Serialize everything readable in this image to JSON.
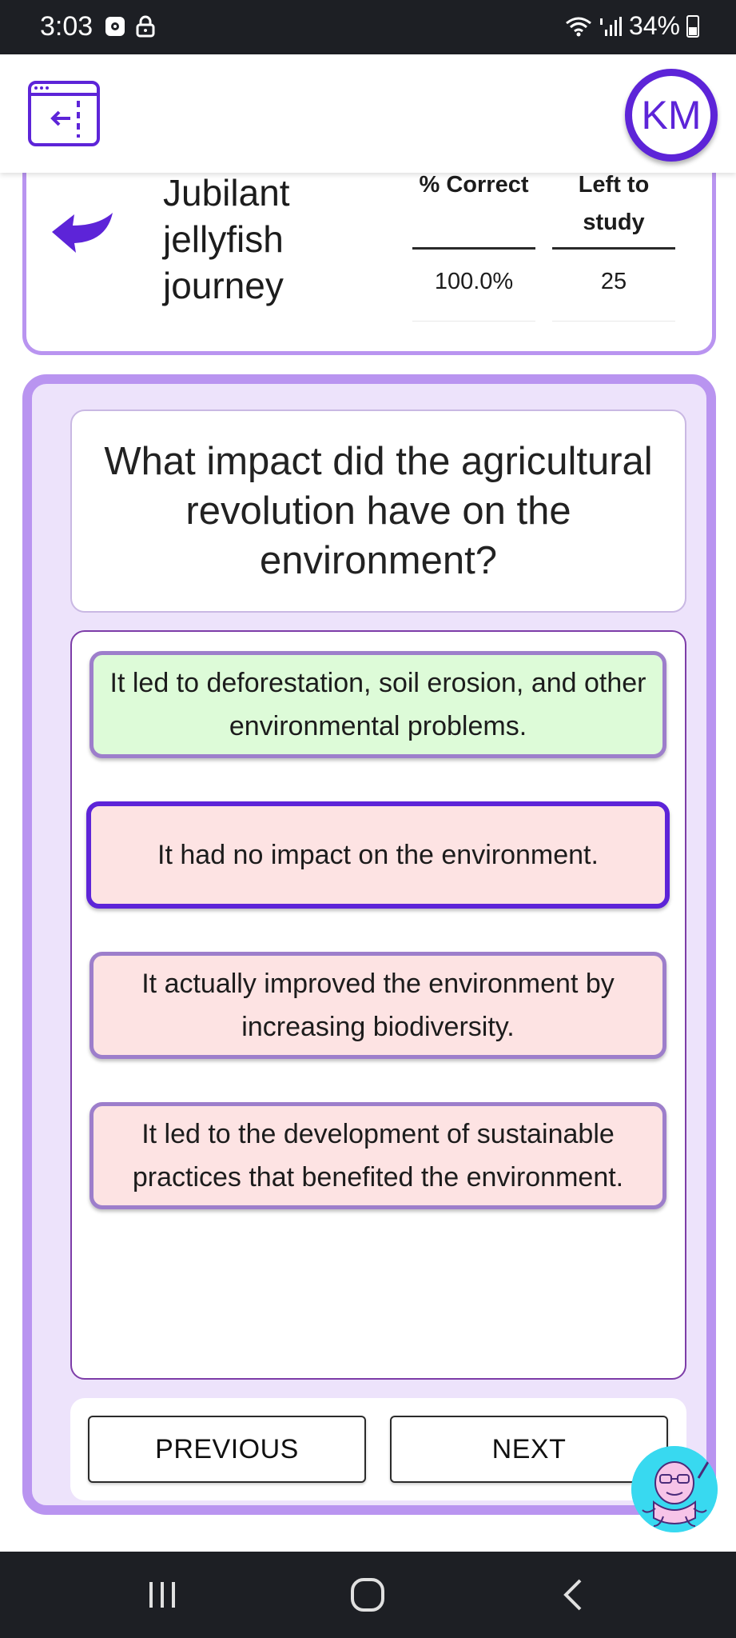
{
  "status_bar": {
    "time": "3:03",
    "battery": "34%",
    "icons": [
      "notification-icon",
      "lock-icon",
      "wifi-icon",
      "signal-icon",
      "battery-icon"
    ]
  },
  "header": {
    "avatar_initials": "KM",
    "accent_color": "#5d24d8"
  },
  "deck": {
    "title": "Jubilant jellyfish journey",
    "stats": [
      {
        "label": "% Correct",
        "value": "100.0%"
      },
      {
        "label": "Left to study",
        "value": "25"
      }
    ]
  },
  "quiz": {
    "question": "What impact did the agricultural revolution have on the environment?",
    "answers": [
      {
        "text": "It led to deforestation, soil erosion, and other environmental problems.",
        "state": "correct"
      },
      {
        "text": "It had no impact on the environment.",
        "state": "selected-incorrect"
      },
      {
        "text": "It actually improved the environment by increasing biodiversity.",
        "state": "incorrect"
      },
      {
        "text": "It led to the development of sustainable practices that benefited the environment.",
        "state": "incorrect"
      }
    ],
    "previous_label": "PREVIOUS",
    "next_label": "NEXT"
  },
  "colors": {
    "panel_border": "#b994f0",
    "panel_bg": "#ede3fb",
    "correct_bg": "#ddfbd8",
    "incorrect_bg": "#fde3e3"
  }
}
